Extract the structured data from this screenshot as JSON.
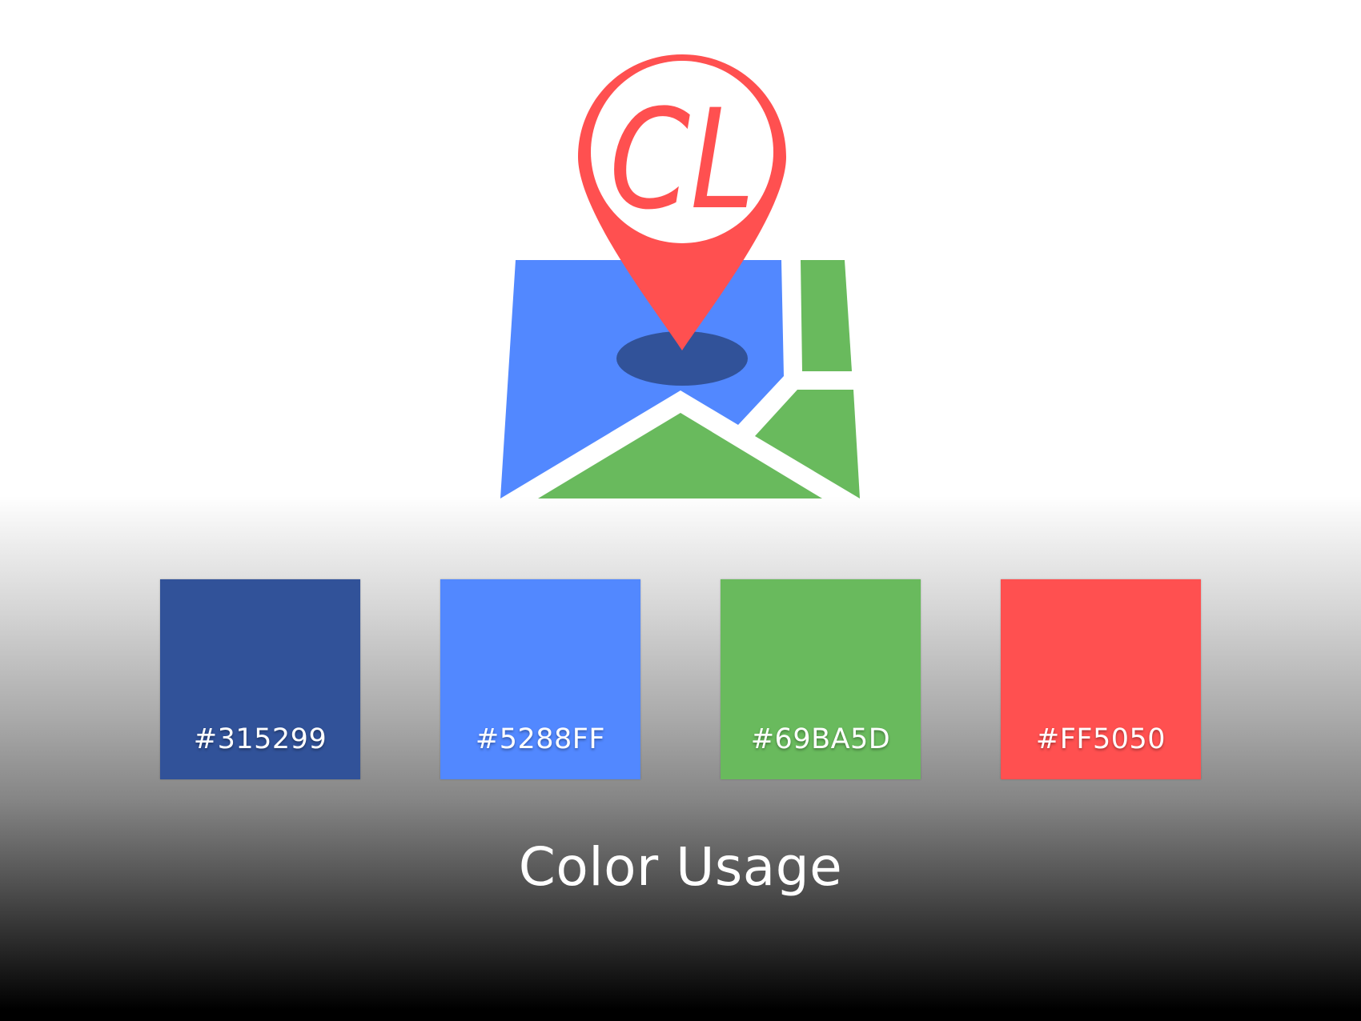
{
  "logo": {
    "monogram": "CL",
    "pin_color": "#FF5050",
    "map_blue": "#5288FF",
    "map_green": "#69BA5D",
    "shadow_color": "#315299"
  },
  "swatches": [
    {
      "hex": "#315299",
      "color": "#315299"
    },
    {
      "hex": "#5288FF",
      "color": "#5288FF"
    },
    {
      "hex": "#69BA5D",
      "color": "#69BA5D"
    },
    {
      "hex": "#FF5050",
      "color": "#FF5050"
    }
  ],
  "title": "Color Usage"
}
